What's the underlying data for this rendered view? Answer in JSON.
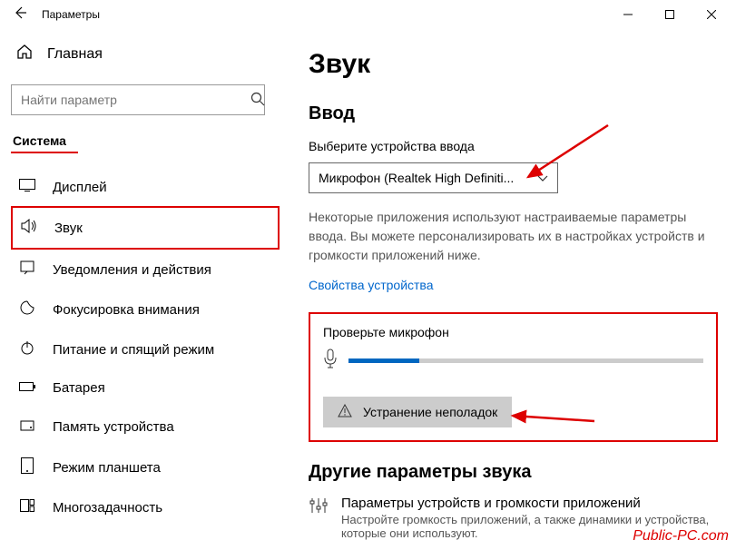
{
  "titlebar": {
    "title": "Параметры"
  },
  "sidebar": {
    "home": "Главная",
    "search_placeholder": "Найти параметр",
    "section": "Система",
    "items": [
      {
        "label": "Дисплей"
      },
      {
        "label": "Звук"
      },
      {
        "label": "Уведомления и действия"
      },
      {
        "label": "Фокусировка внимания"
      },
      {
        "label": "Питание и спящий режим"
      },
      {
        "label": "Батарея"
      },
      {
        "label": "Память устройства"
      },
      {
        "label": "Режим планшета"
      },
      {
        "label": "Многозадачность"
      }
    ]
  },
  "main": {
    "h1": "Звук",
    "input_heading": "Ввод",
    "select_device": "Выберите устройства ввода",
    "device_value": "Микрофон (Realtek High Definiti...",
    "desc": "Некоторые приложения используют настраиваемые параметры ввода. Вы можете персонализировать их в настройках устройств и громкости приложений ниже.",
    "device_props": "Свойства устройства",
    "test_label": "Проверьте микрофон",
    "troubleshoot": "Устранение неполадок",
    "other_heading": "Другие параметры звука",
    "app_title": "Параметры устройств и громкости приложений",
    "app_desc": "Настройте громкость приложений, а также динамики и устройства, которые они используют."
  },
  "watermark": "Public-PC.com"
}
